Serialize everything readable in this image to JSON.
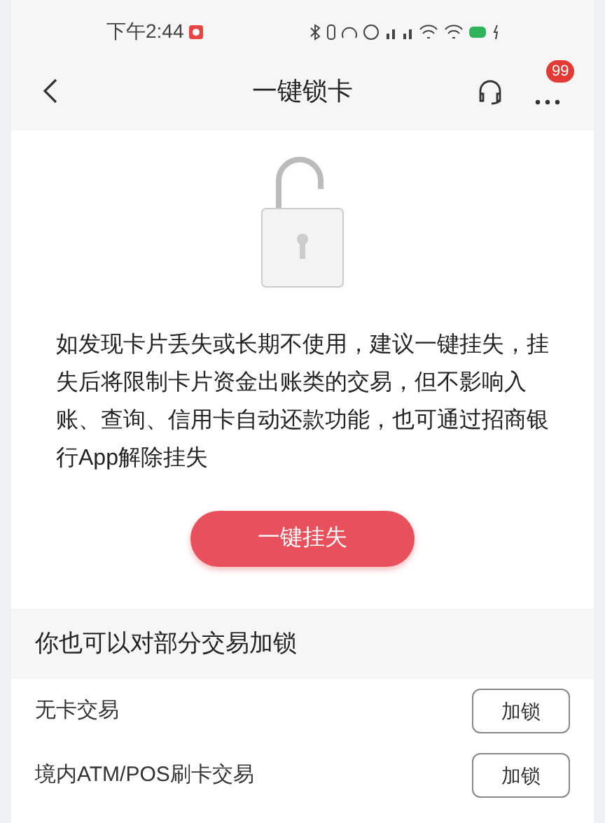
{
  "status_bar": {
    "time": "下午2:44"
  },
  "header": {
    "title": "一键锁卡",
    "badge": "99"
  },
  "intro": {
    "text": "如发现卡片丢失或长期不使用，建议一键挂失，挂失后将限制卡片资金出账类的交易，但不影响入账、查询、信用卡自动还款功能，也可通过招商银行App解除挂失",
    "button": "一键挂失"
  },
  "section": {
    "title": "你也可以对部分交易加锁"
  },
  "rows": [
    {
      "label": "无卡交易",
      "button": "加锁"
    },
    {
      "label": "境内ATM/POS刷卡交易",
      "button": "加锁"
    }
  ]
}
